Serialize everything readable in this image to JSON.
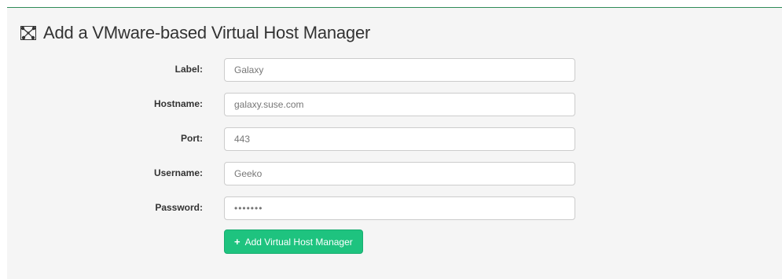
{
  "page": {
    "title": "Add a VMware-based Virtual Host Manager",
    "title_icon": "network-nodes-icon"
  },
  "form": {
    "fields": [
      {
        "label": "Label:",
        "value": "Galaxy",
        "type": "text"
      },
      {
        "label": "Hostname:",
        "value": "galaxy.suse.com",
        "type": "text"
      },
      {
        "label": "Port:",
        "value": "443",
        "type": "text"
      },
      {
        "label": "Username:",
        "value": "Geeko",
        "type": "text"
      },
      {
        "label": "Password:",
        "value": "•••••••",
        "type": "password"
      }
    ],
    "submit_label": "Add Virtual Host Manager",
    "submit_icon": "plus-icon"
  },
  "colors": {
    "accent_line": "#2e8b57",
    "button_bg": "#1ec37f"
  }
}
